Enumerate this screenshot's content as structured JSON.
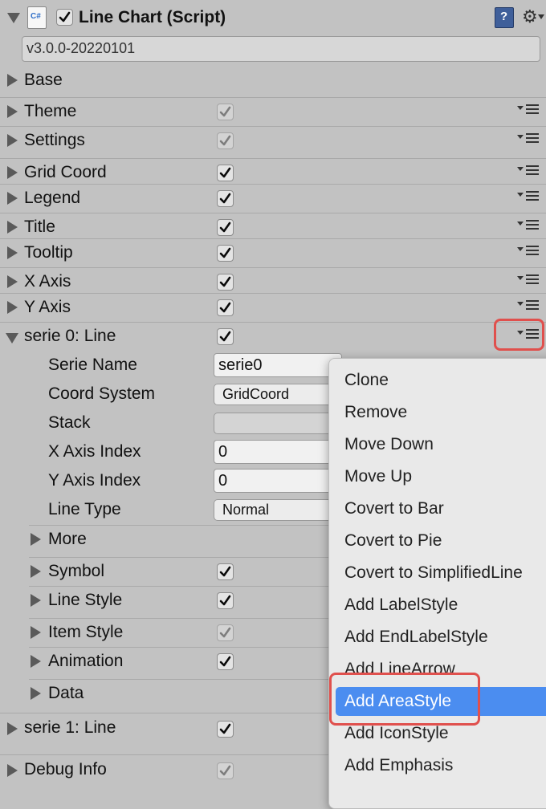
{
  "header": {
    "title": "Line Chart (Script)",
    "script_icon_text": "C#",
    "enabled": true,
    "icons": [
      "book-icon",
      "gear-icon"
    ]
  },
  "version": "v3.0.0-20220101",
  "sections": [
    {
      "label": "Base",
      "checkbox": null
    },
    {
      "label": "Theme",
      "checkbox": "dim"
    },
    {
      "label": "Settings",
      "checkbox": "dim"
    },
    {
      "label": "Grid Coord",
      "checkbox": "on"
    },
    {
      "label": "Legend",
      "checkbox": "on"
    },
    {
      "label": "Title",
      "checkbox": "on"
    },
    {
      "label": "Tooltip",
      "checkbox": "on"
    },
    {
      "label": "X Axis",
      "checkbox": "on"
    },
    {
      "label": "Y Axis",
      "checkbox": "on"
    },
    {
      "label": "serie 0: Line",
      "checkbox": "on",
      "expanded": true
    }
  ],
  "serie0": {
    "fields": [
      {
        "label": "Serie Name",
        "value": "serie0",
        "kind": "text"
      },
      {
        "label": "Coord System",
        "value": "GridCoord",
        "kind": "select"
      },
      {
        "label": "Stack",
        "value": "",
        "kind": "select-empty"
      },
      {
        "label": "X Axis Index",
        "value": "0",
        "kind": "text"
      },
      {
        "label": "Y Axis Index",
        "value": "0",
        "kind": "text"
      },
      {
        "label": "Line Type",
        "value": "Normal",
        "kind": "select"
      }
    ],
    "subsections": [
      {
        "label": "More",
        "checkbox": null
      },
      {
        "label": "Symbol",
        "checkbox": "on"
      },
      {
        "label": "Line Style",
        "checkbox": "on"
      },
      {
        "label": "Item Style",
        "checkbox": "dim"
      },
      {
        "label": "Animation",
        "checkbox": "on"
      },
      {
        "label": "Data",
        "checkbox": null
      }
    ]
  },
  "bottom_sections": [
    {
      "label": "serie 1: Line",
      "checkbox": "on"
    },
    {
      "label": "Debug Info",
      "checkbox": "dim"
    }
  ],
  "context_menu": {
    "items": [
      "Clone",
      "Remove",
      "Move Down",
      "Move Up",
      "Covert to Bar",
      "Covert to Pie",
      "Covert to SimplifiedLine",
      "Add LabelStyle",
      "Add EndLabelStyle",
      "Add LineArrow",
      "Add AreaStyle",
      "Add IconStyle",
      "Add Emphasis"
    ],
    "selected": "Add AreaStyle"
  },
  "colors": {
    "panel_bg": "#c2c2c2",
    "menu_bg": "#e9e9e9",
    "selection": "#4b8df0",
    "highlight_box": "#e0504d"
  }
}
